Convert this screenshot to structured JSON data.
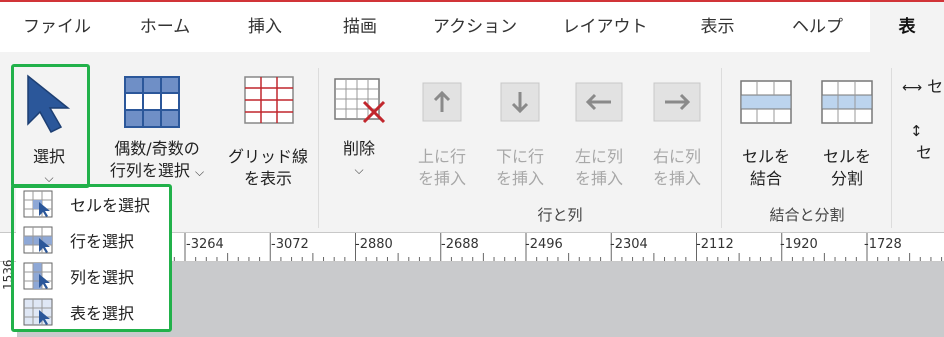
{
  "tabs": [
    "ファイル",
    "ホーム",
    "挿入",
    "描画",
    "アクション",
    "レイアウト",
    "表示",
    "ヘルプ",
    "表"
  ],
  "active_tab": "表",
  "ribbon": {
    "select": {
      "label": "選択",
      "arrow": "⌵"
    },
    "even_odd": {
      "label1": "偶数/奇数の",
      "label2": "行列を選択",
      "arrow": "⌵"
    },
    "gridlines": {
      "label1": "グリッド線",
      "label2": "を表示"
    },
    "delete": {
      "label": "削除",
      "arrow": "⌵"
    },
    "insert_above": {
      "label1": "上に行",
      "label2": "を挿入"
    },
    "insert_below": {
      "label1": "下に行",
      "label2": "を挿入"
    },
    "insert_left": {
      "label1": "左に列",
      "label2": "を挿入"
    },
    "insert_right": {
      "label1": "右に列",
      "label2": "を挿入"
    },
    "merge": {
      "label1": "セルを",
      "label2": "結合"
    },
    "split": {
      "label1": "セルを",
      "label2": "分割"
    },
    "group_rows_cols": "行と列",
    "group_merge_split": "結合と分割",
    "partial_width": "セ",
    "partial_height": "セ"
  },
  "ruler": {
    "numbers": [
      "-3264",
      "-3072",
      "-2880",
      "-2688",
      "-2496",
      "-2304",
      "-2112",
      "-1920",
      "-1728"
    ],
    "vertical_text": "1536"
  },
  "menu": {
    "items": [
      {
        "label": "セルを選択"
      },
      {
        "label": "行を選択"
      },
      {
        "label": "列を選択"
      },
      {
        "label": "表を選択"
      }
    ]
  },
  "colors": {
    "accent_red": "#d13438",
    "highlight_green": "#21b14a",
    "icon_blue": "#2b579a"
  }
}
